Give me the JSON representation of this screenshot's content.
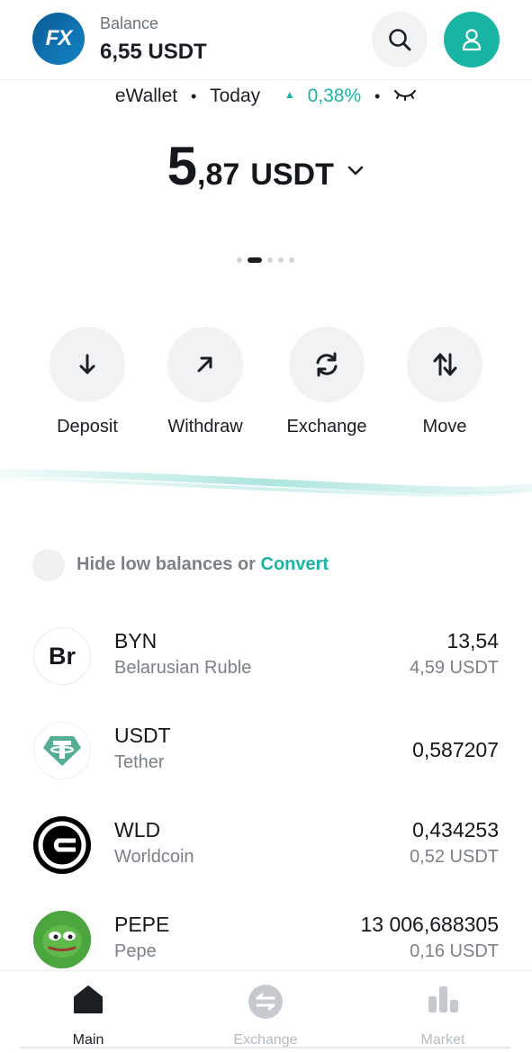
{
  "header": {
    "logo_text": "FX",
    "balance_label": "Balance",
    "balance_value": "6,55 USDT"
  },
  "wallet": {
    "name": "eWallet",
    "period": "Today",
    "change": "0,38%",
    "amount_int": "5",
    "amount_frac": ",87",
    "currency": "USDT",
    "pager_active_index": 1,
    "pager_count": 5
  },
  "actions": [
    {
      "label": "Deposit",
      "icon": "arrow-down-icon"
    },
    {
      "label": "Withdraw",
      "icon": "arrow-up-right-icon"
    },
    {
      "label": "Exchange",
      "icon": "refresh-icon"
    },
    {
      "label": "Move",
      "icon": "swap-vertical-icon"
    }
  ],
  "filter": {
    "hide_text": "Hide low balances or",
    "convert_text": "Convert"
  },
  "assets": [
    {
      "symbol": "BYN",
      "name": "Belarusian Ruble",
      "amount": "13,54",
      "fiat": "4,59 USDT",
      "icon_text": "Br"
    },
    {
      "symbol": "USDT",
      "name": "Tether",
      "amount": "0,587207",
      "fiat": ""
    },
    {
      "symbol": "WLD",
      "name": "Worldcoin",
      "amount": "0,434253",
      "fiat": "0,52 USDT"
    },
    {
      "symbol": "PEPE",
      "name": "Pepe",
      "amount": "13 006,688305",
      "fiat": "0,16 USDT"
    }
  ],
  "nav": [
    {
      "label": "Main",
      "icon": "home-icon",
      "active": true
    },
    {
      "label": "Exchange",
      "icon": "exchange-icon",
      "active": false
    },
    {
      "label": "Market",
      "icon": "bar-chart-icon",
      "active": false
    }
  ],
  "colors": {
    "accent": "#19b5a4",
    "brand_blue": "#0a5a96",
    "text_primary": "#14181c",
    "text_secondary": "#7b8187"
  }
}
